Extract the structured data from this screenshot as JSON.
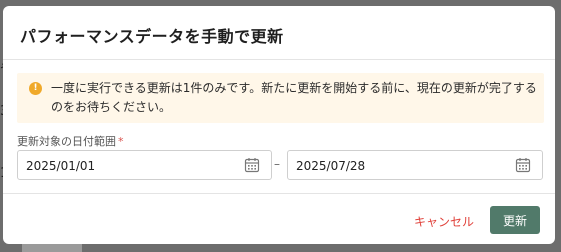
{
  "modal": {
    "title": "パフォーマンスデータを手動で更新",
    "notice": {
      "icon": "info-icon",
      "icon_glyph": "!",
      "text": "一度に実行できる更新は1件のみです。新たに更新を開始する前に、現在の更新が完了するのをお待ちください。"
    },
    "date_range": {
      "label": "更新対象の日付範囲",
      "required_mark": "*",
      "start": "2025/01/01",
      "separator": "–",
      "end": "2025/07/28",
      "icon": "calendar-icon"
    },
    "footer": {
      "cancel_label": "キャンセル",
      "submit_label": "更新"
    }
  },
  "colors": {
    "warning": "#f0a92a",
    "notice_bg": "#fff7e9",
    "primary": "#517a6a",
    "danger": "#e0413a"
  }
}
